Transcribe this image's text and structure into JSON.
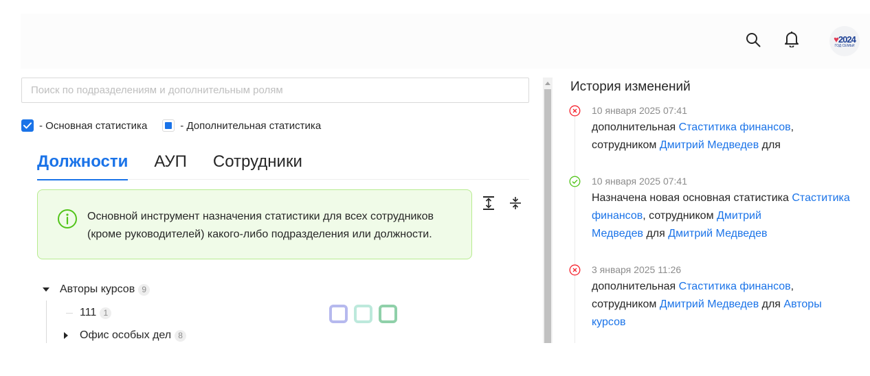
{
  "header": {
    "icons": [
      "search-icon",
      "bell-icon"
    ],
    "avatar": {
      "year": "2024",
      "subtitle": "ГОД СЕМЬИ"
    }
  },
  "search": {
    "placeholder": "Поиск по подразделениям и дополнительным ролям",
    "value": ""
  },
  "legend": {
    "main_label": "- Основная статистика",
    "additional_label": "- Дополнительная статистика"
  },
  "tabs": [
    {
      "label": "Должности",
      "active": true
    },
    {
      "label": "АУП",
      "active": false
    },
    {
      "label": "Сотрудники",
      "active": false
    }
  ],
  "info": {
    "line1": "Основной инструмент назначения статистики для всех сотрудников",
    "line2": "(кроме руководителей) какого-либо подразделения или должности."
  },
  "tree": {
    "nodes": [
      {
        "label": "Авторы курсов",
        "count": "9",
        "expanded": true
      },
      {
        "label": "111",
        "count": "1"
      },
      {
        "label": "Офис особых дел",
        "count": "8",
        "expanded": false
      }
    ],
    "square_colors": [
      "#b6b9ee",
      "#bde9dc",
      "#8fd0a9"
    ]
  },
  "history": {
    "title": "История изменений",
    "entries": [
      {
        "status": "error",
        "date": "10 января 2025 07:41",
        "l1_text": "дополнительная ",
        "l1_link": "Стаститика финансов",
        "l1_tail": ",",
        "l2_text": "сотрудником ",
        "l2_link": "Дмитрий Медведев",
        "l2_tail": " для"
      },
      {
        "status": "success",
        "date": "10 января 2025 07:41",
        "l1_text": "Назначена новая основная статистика ",
        "l1_link": "Стаститика",
        "l2_link": "финансов",
        "l2_text": ", сотрудником ",
        "l2_link2": "Дмитрий",
        "l3_link": "Медведев",
        "l3_text": " для ",
        "l3_link2": "Дмитрий Медведев"
      },
      {
        "status": "error",
        "date": "3 января 2025 11:26",
        "l1_text": "дополнительная ",
        "l1_link": "Стаститика финансов",
        "l1_tail": ",",
        "l2_text": "сотрудником ",
        "l2_link": "Дмитрий Медведев",
        "l2_mid": " для ",
        "l2_link2": "Авторы",
        "l3_link": "курсов"
      }
    ]
  },
  "colors": {
    "accent": "#1a73e8",
    "error": "#f5222d",
    "success": "#52c41a",
    "info_bg": "#f0fbe8",
    "info_border": "#b7eb8f"
  }
}
